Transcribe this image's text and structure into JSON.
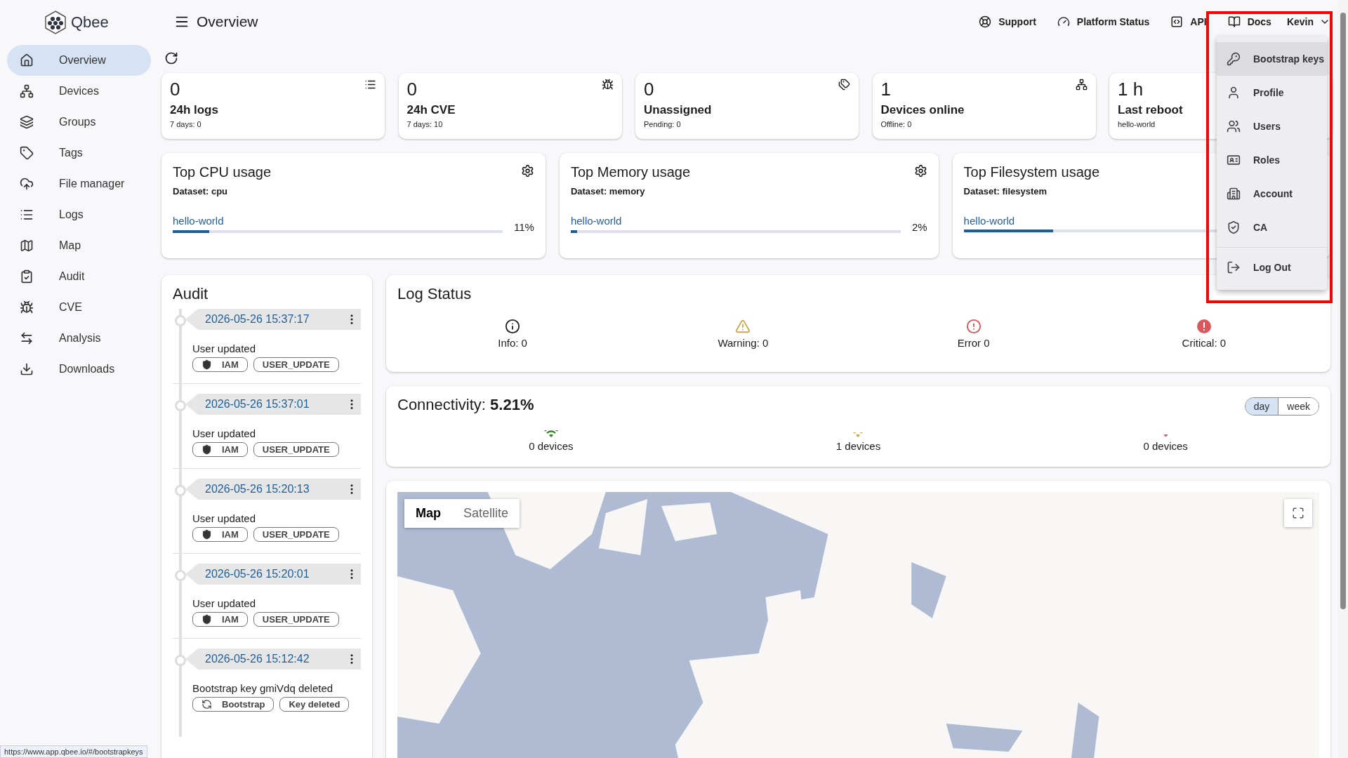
{
  "app": {
    "logo": "Qbee",
    "page_title": "Overview"
  },
  "header_links": [
    {
      "label": "Support",
      "kind": "support"
    },
    {
      "label": "Platform Status",
      "kind": "status"
    },
    {
      "label": "API",
      "kind": "api"
    },
    {
      "label": "Docs",
      "kind": "docs"
    }
  ],
  "user_menu": {
    "label": "Kevin",
    "expanded": true,
    "items": [
      {
        "label": "Bootstrap keys",
        "kind": "key",
        "selected": true
      },
      {
        "label": "Profile",
        "kind": "profile",
        "selected": false
      },
      {
        "label": "Users",
        "kind": "users",
        "selected": false
      },
      {
        "label": "Roles",
        "kind": "roles",
        "selected": false
      },
      {
        "label": "Account",
        "kind": "account",
        "selected": false
      },
      {
        "label": "CA",
        "kind": "ca",
        "selected": false
      },
      {
        "label": "Log Out",
        "kind": "logout",
        "selected": false
      }
    ]
  },
  "sidebar": {
    "items": [
      {
        "label": "Overview",
        "kind": "home",
        "selected": true
      },
      {
        "label": "Devices",
        "kind": "devices",
        "selected": false
      },
      {
        "label": "Groups",
        "kind": "groups",
        "selected": false
      },
      {
        "label": "Tags",
        "kind": "tags",
        "selected": false
      },
      {
        "label": "File manager",
        "kind": "files",
        "selected": false
      },
      {
        "label": "Logs",
        "kind": "logs",
        "selected": false
      },
      {
        "label": "Map",
        "kind": "map",
        "selected": false
      },
      {
        "label": "Audit",
        "kind": "audit",
        "selected": false
      },
      {
        "label": "CVE",
        "kind": "cve",
        "selected": false
      },
      {
        "label": "Analysis",
        "kind": "analysis",
        "selected": false
      },
      {
        "label": "Downloads",
        "kind": "downloads",
        "selected": false
      }
    ]
  },
  "stat_cards": [
    {
      "value": "0",
      "title": "24h logs",
      "detail": "7 days: 0",
      "kind": "logs"
    },
    {
      "value": "0",
      "title": "24h CVE",
      "detail": "7 days: 10",
      "kind": "cve"
    },
    {
      "value": "0",
      "title": "Unassigned",
      "detail": "Pending: 0",
      "kind": "unassigned"
    },
    {
      "value": "1",
      "title": "Devices online",
      "detail": "Offline: 0",
      "kind": "devices"
    },
    {
      "value": "1 h",
      "title": "Last reboot",
      "detail": "hello-world",
      "kind": "reboot"
    }
  ],
  "usage_cards": [
    {
      "title": "Top CPU usage",
      "dataset": "Dataset: cpu",
      "device": "hello-world",
      "level": 0.11,
      "reading": "11%",
      "settings_button": true
    },
    {
      "title": "Top Memory usage",
      "dataset": "Dataset: memory",
      "device": "hello-world",
      "level": 0.02,
      "reading": "2%",
      "settings_button": true
    },
    {
      "title": "Top Filesystem usage",
      "dataset": "Dataset: filesystem",
      "device": "hello-world",
      "level": 0.27
    }
  ],
  "audit": {
    "title": "Audit",
    "entries": [
      {
        "time": "2026-05-26 15:37:17",
        "text": "User updated",
        "tags": [
          {
            "label": "IAM",
            "kind": "shield"
          },
          {
            "label": "USER_UPDATE",
            "kind": "plain"
          }
        ]
      },
      {
        "time": "2026-05-26 15:37:01",
        "text": "User updated",
        "tags": [
          {
            "label": "IAM",
            "kind": "shield"
          },
          {
            "label": "USER_UPDATE",
            "kind": "plain"
          }
        ]
      },
      {
        "time": "2026-05-26 15:20:13",
        "text": "User updated",
        "tags": [
          {
            "label": "IAM",
            "kind": "shield"
          },
          {
            "label": "USER_UPDATE",
            "kind": "plain"
          }
        ]
      },
      {
        "time": "2026-05-26 15:20:01",
        "text": "User updated",
        "tags": [
          {
            "label": "IAM",
            "kind": "shield"
          },
          {
            "label": "USER_UPDATE",
            "kind": "plain"
          }
        ]
      },
      {
        "time": "2026-05-26 15:12:42",
        "text": "Bootstrap key gmiVdq deleted",
        "tags": [
          {
            "label": "Bootstrap",
            "kind": "bootstrap"
          },
          {
            "label": "Key deleted",
            "kind": "plain"
          }
        ]
      }
    ]
  },
  "log_status": {
    "title": "Log Status",
    "items": [
      {
        "label": "Info: 0",
        "kind": "info"
      },
      {
        "label": "Warning: 0",
        "kind": "warning"
      },
      {
        "label": "Error 0",
        "kind": "error"
      },
      {
        "label": "Critical: 0",
        "kind": "critical"
      }
    ]
  },
  "connectivity": {
    "title": "Connectivity:",
    "value": "5.21%",
    "range": [
      {
        "label": "day",
        "selected": true
      },
      {
        "label": "week",
        "selected": false
      }
    ],
    "items": [
      {
        "label": "0 devices",
        "kind": "good"
      },
      {
        "label": "1 devices",
        "kind": "fair"
      },
      {
        "label": "0 devices",
        "kind": "poor"
      }
    ]
  },
  "map": {
    "kind": "picture",
    "types": [
      {
        "label": "Map",
        "selected": true
      },
      {
        "label": "Satellite",
        "selected": false
      }
    ]
  },
  "status_url": "https://www.app.qbee.io/#/bootstrapkeys"
}
